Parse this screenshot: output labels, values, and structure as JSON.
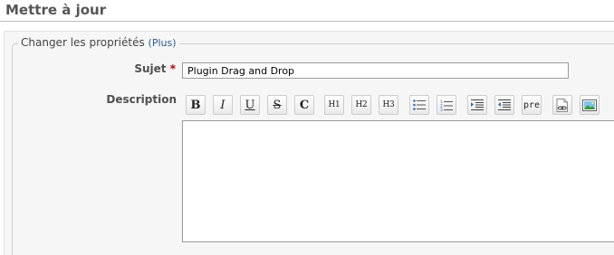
{
  "page": {
    "title": "Mettre à jour"
  },
  "fieldset": {
    "legend": "Changer les propriétés",
    "more_link": "(Plus)"
  },
  "form": {
    "subject_label": "Sujet",
    "required_mark": "*",
    "subject_value": "Plugin Drag and Drop",
    "description_label": "Description",
    "description_value": ""
  },
  "toolbar": {
    "bold": "B",
    "italic": "I",
    "underline": "U",
    "strike": "S",
    "code": "C",
    "h1": "H1",
    "h2": "H2",
    "h3": "H3",
    "unordered_list_icon": "bullet-list-icon",
    "ordered_list_icon": "numbered-list-icon",
    "indent_icon": "indent-icon",
    "outdent_icon": "outdent-icon",
    "pre": "pre",
    "link_icon": "link-page-icon",
    "image_icon": "image-icon"
  },
  "colors": {
    "accent": "#bb0000",
    "link": "#2a5a8a",
    "panel": "#f6f6f6"
  }
}
